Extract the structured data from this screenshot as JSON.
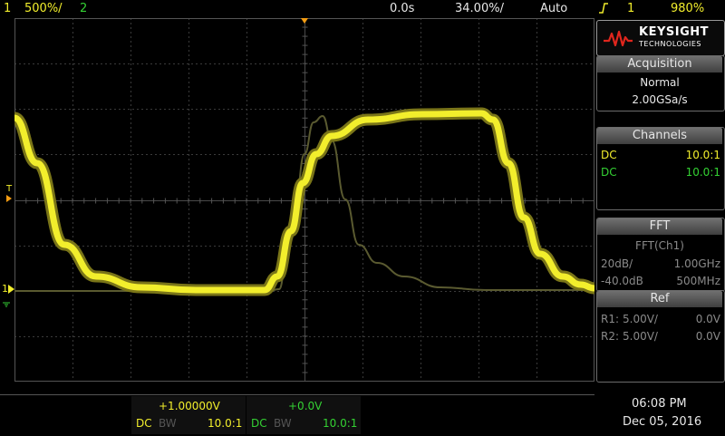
{
  "topbar": {
    "ch1_num": "1",
    "ch1_scale": "500%/",
    "ch2_num": "2",
    "time_ref": "0.0s",
    "time_scale": "34.00%/",
    "trigger_mode": "Auto",
    "trigger_icon": "rising-edge-icon",
    "trigger_source": "1",
    "trigger_level": "980%"
  },
  "brand": {
    "name": "KEYSIGHT",
    "sub": "TECHNOLOGIES"
  },
  "acquisition": {
    "title": "Acquisition",
    "mode": "Normal",
    "rate": "2.00GSa/s"
  },
  "channels": {
    "title": "Channels",
    "rows": [
      {
        "coupling": "DC",
        "probe": "10.0:1"
      },
      {
        "coupling": "DC",
        "probe": "10.0:1"
      }
    ]
  },
  "fft": {
    "title": "FFT",
    "source": "FFT(Ch1)",
    "scale": "20dB/",
    "span": "1.00GHz",
    "ref_level": "-40.0dB",
    "center": "500MHz"
  },
  "ref": {
    "title": "Ref",
    "rows": [
      {
        "name": "R1:",
        "scale": "5.00V/",
        "offset": "0.0V"
      },
      {
        "name": "R2:",
        "scale": "5.00V/",
        "offset": "0.0V"
      }
    ]
  },
  "bottom": {
    "ch1": {
      "offset": "+1.00000V",
      "coupling": "DC",
      "bw": "BW",
      "probe": "10.0:1"
    },
    "ch2": {
      "offset": "+0.0V",
      "coupling": "DC",
      "bw": "BW",
      "probe": "10.0:1"
    },
    "time": "06:08 PM",
    "date": "Dec 05, 2016"
  },
  "markers": {
    "trigger_level_label": "T",
    "ch1_ground_label": "1"
  },
  "colors": {
    "ch1": "#f2ee2c",
    "ch2": "#34d133",
    "grid": "#3a3a3a",
    "trigger_marker": "#f39c12"
  }
}
